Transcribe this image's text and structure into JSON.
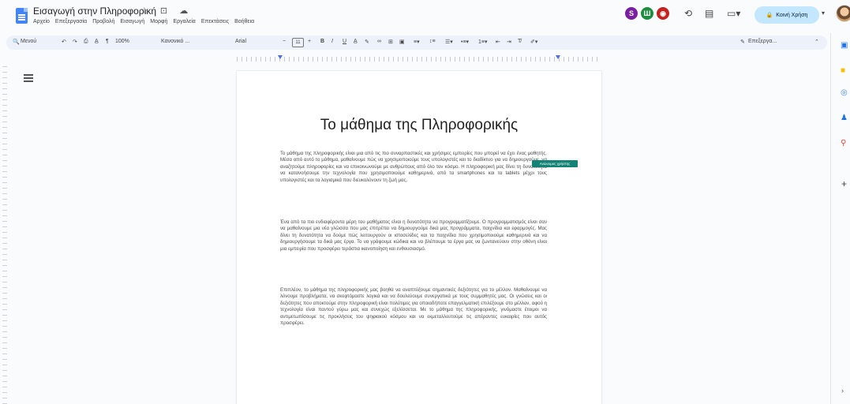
{
  "header": {
    "doc_title": "Εισαγωγή στην Πληροφορική",
    "title_icons": "☆ ⊡ ☁",
    "menus": [
      "Αρχείο",
      "Επεξεργασία",
      "Προβολή",
      "Εισαγωγή",
      "Μορφή",
      "Εργαλεία",
      "Επεκτάσεις",
      "Βοήθεια"
    ],
    "avatars": [
      {
        "letter": "S",
        "color": "#7a1fa2"
      },
      {
        "letter": "Ш",
        "color": "#1e8e3e"
      },
      {
        "letter": "◉",
        "color": "#c5221f"
      }
    ],
    "share_label": "Κοινή Χρήση",
    "icons": [
      "history-icon",
      "comment-icon",
      "meet-icon"
    ]
  },
  "toolbar": {
    "search": "Μενού",
    "zoom": "100%",
    "style": "Κανονικό ...",
    "font": "Arial",
    "font_size": "11",
    "editing_mode": "Επεξεργα..."
  },
  "document": {
    "heading": "Το μάθημα της Πληροφορικής",
    "paragraphs": [
      "Το μάθημα της πληροφορικής είναι μια από τις πιο συναρπαστικές και χρήσιμες εμπειρίες που μπορεί να έχει ένας μαθητής. Μέσα από αυτό το μάθημα, μαθαίνουμε πώς να χρησιμοποιούμε τους υπολογιστές και το διαδίκτυο για να δημιουργούμε, να αναζητούμε πληροφορίες και να επικοινωνούμε με ανθρώπους από όλο τον κόσμο. Η πληροφορική μας δίνει τη δυνατότητα να κατανοήσουμε την τεχνολογία που χρησιμοποιούμε καθημερινά, από τα smartphones και τα tablets μέχρι τους υπολογιστές και τα λογισμικά που διευκολύνουν τη ζωή μας.",
      "Ένα από τα πιο ενδιαφέροντα μέρη του μαθήματος είναι η δυνατότητα να προγραμματίζουμε. Ο προγραμματισμός είναι σαν να μαθαίνουμε μια νέα γλώσσα που μας επιτρέπει να δημιουργούμε δικά μας προγράμματα, παιχνίδια και εφαρμογές. Μας δίνει τη δυνατότητα να δούμε πώς λειτουργούν οι ιστοσελίδες και τα παιχνίδια που χρησιμοποιούμε καθημερινά και να δημιουργήσουμε τα δικά μας έργα. Το να γράφουμε κώδικα και να βλέπουμε τα έργα μας να ζωντανεύουν στην οθόνη είναι μια εμπειρία που προσφέρει τεράστια ικανοποίηση και ενθουσιασμό.",
      "Επιπλέον, το μάθημα της πληροφορικής μας βοηθά να αναπτύξουμε σημαντικές δεξιότητες για το μέλλον. Μαθαίνουμε να λύνουμε προβλήματα, να σκεφτόμαστε λογικά και να δουλεύουμε συνεργατικά με τους συμμαθητές μας. Οι γνώσεις και οι δεξιότητες που αποκτούμε στην πληροφορική είναι πολύτιμες για οποιαδήποτε επαγγελματική επιλέξουμε στο μέλλον, αφού η τεχνολογία είναι παντού γύρω μας και συνεχώς εξελίσσεται. Με το μάθημα της πληροφορικής, γινόμαστε έτοιμοι να αντιμετωπίσουμε τις προκλήσεις του ψηφιακού κόσμου και να εκμεταλλευτούμε τις απέραντες ευκαιρίες που αυτός προσφέρει."
    ],
    "comment_tag": "Ανώνυμος χρήστης"
  },
  "colors": {
    "accent": "#4285f4",
    "share_bg": "#c2e7ff",
    "comment_tag": "#128375",
    "highlight": "#fde293"
  }
}
